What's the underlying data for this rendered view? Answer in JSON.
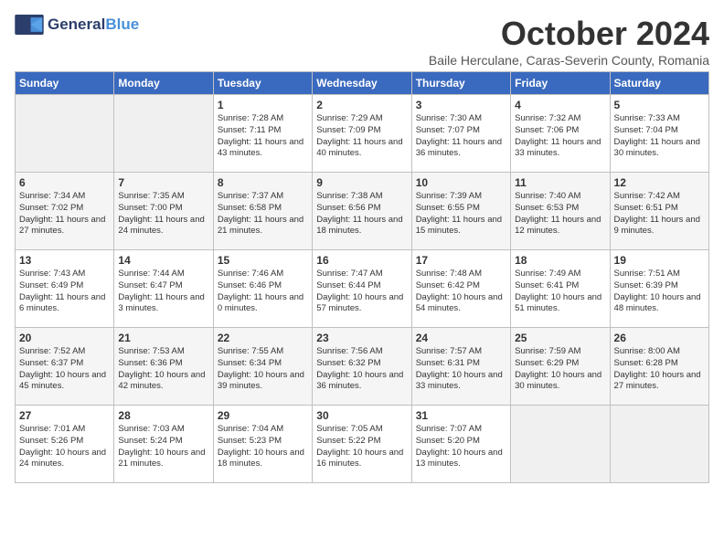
{
  "logo": {
    "general": "General",
    "blue": "Blue"
  },
  "title": "October 2024",
  "subtitle": "Baile Herculane, Caras-Severin County, Romania",
  "weekdays": [
    "Sunday",
    "Monday",
    "Tuesday",
    "Wednesday",
    "Thursday",
    "Friday",
    "Saturday"
  ],
  "weeks": [
    [
      {
        "day": "",
        "detail": ""
      },
      {
        "day": "",
        "detail": ""
      },
      {
        "day": "1",
        "detail": "Sunrise: 7:28 AM\nSunset: 7:11 PM\nDaylight: 11 hours and 43 minutes."
      },
      {
        "day": "2",
        "detail": "Sunrise: 7:29 AM\nSunset: 7:09 PM\nDaylight: 11 hours and 40 minutes."
      },
      {
        "day": "3",
        "detail": "Sunrise: 7:30 AM\nSunset: 7:07 PM\nDaylight: 11 hours and 36 minutes."
      },
      {
        "day": "4",
        "detail": "Sunrise: 7:32 AM\nSunset: 7:06 PM\nDaylight: 11 hours and 33 minutes."
      },
      {
        "day": "5",
        "detail": "Sunrise: 7:33 AM\nSunset: 7:04 PM\nDaylight: 11 hours and 30 minutes."
      }
    ],
    [
      {
        "day": "6",
        "detail": "Sunrise: 7:34 AM\nSunset: 7:02 PM\nDaylight: 11 hours and 27 minutes."
      },
      {
        "day": "7",
        "detail": "Sunrise: 7:35 AM\nSunset: 7:00 PM\nDaylight: 11 hours and 24 minutes."
      },
      {
        "day": "8",
        "detail": "Sunrise: 7:37 AM\nSunset: 6:58 PM\nDaylight: 11 hours and 21 minutes."
      },
      {
        "day": "9",
        "detail": "Sunrise: 7:38 AM\nSunset: 6:56 PM\nDaylight: 11 hours and 18 minutes."
      },
      {
        "day": "10",
        "detail": "Sunrise: 7:39 AM\nSunset: 6:55 PM\nDaylight: 11 hours and 15 minutes."
      },
      {
        "day": "11",
        "detail": "Sunrise: 7:40 AM\nSunset: 6:53 PM\nDaylight: 11 hours and 12 minutes."
      },
      {
        "day": "12",
        "detail": "Sunrise: 7:42 AM\nSunset: 6:51 PM\nDaylight: 11 hours and 9 minutes."
      }
    ],
    [
      {
        "day": "13",
        "detail": "Sunrise: 7:43 AM\nSunset: 6:49 PM\nDaylight: 11 hours and 6 minutes."
      },
      {
        "day": "14",
        "detail": "Sunrise: 7:44 AM\nSunset: 6:47 PM\nDaylight: 11 hours and 3 minutes."
      },
      {
        "day": "15",
        "detail": "Sunrise: 7:46 AM\nSunset: 6:46 PM\nDaylight: 11 hours and 0 minutes."
      },
      {
        "day": "16",
        "detail": "Sunrise: 7:47 AM\nSunset: 6:44 PM\nDaylight: 10 hours and 57 minutes."
      },
      {
        "day": "17",
        "detail": "Sunrise: 7:48 AM\nSunset: 6:42 PM\nDaylight: 10 hours and 54 minutes."
      },
      {
        "day": "18",
        "detail": "Sunrise: 7:49 AM\nSunset: 6:41 PM\nDaylight: 10 hours and 51 minutes."
      },
      {
        "day": "19",
        "detail": "Sunrise: 7:51 AM\nSunset: 6:39 PM\nDaylight: 10 hours and 48 minutes."
      }
    ],
    [
      {
        "day": "20",
        "detail": "Sunrise: 7:52 AM\nSunset: 6:37 PM\nDaylight: 10 hours and 45 minutes."
      },
      {
        "day": "21",
        "detail": "Sunrise: 7:53 AM\nSunset: 6:36 PM\nDaylight: 10 hours and 42 minutes."
      },
      {
        "day": "22",
        "detail": "Sunrise: 7:55 AM\nSunset: 6:34 PM\nDaylight: 10 hours and 39 minutes."
      },
      {
        "day": "23",
        "detail": "Sunrise: 7:56 AM\nSunset: 6:32 PM\nDaylight: 10 hours and 36 minutes."
      },
      {
        "day": "24",
        "detail": "Sunrise: 7:57 AM\nSunset: 6:31 PM\nDaylight: 10 hours and 33 minutes."
      },
      {
        "day": "25",
        "detail": "Sunrise: 7:59 AM\nSunset: 6:29 PM\nDaylight: 10 hours and 30 minutes."
      },
      {
        "day": "26",
        "detail": "Sunrise: 8:00 AM\nSunset: 6:28 PM\nDaylight: 10 hours and 27 minutes."
      }
    ],
    [
      {
        "day": "27",
        "detail": "Sunrise: 7:01 AM\nSunset: 5:26 PM\nDaylight: 10 hours and 24 minutes."
      },
      {
        "day": "28",
        "detail": "Sunrise: 7:03 AM\nSunset: 5:24 PM\nDaylight: 10 hours and 21 minutes."
      },
      {
        "day": "29",
        "detail": "Sunrise: 7:04 AM\nSunset: 5:23 PM\nDaylight: 10 hours and 18 minutes."
      },
      {
        "day": "30",
        "detail": "Sunrise: 7:05 AM\nSunset: 5:22 PM\nDaylight: 10 hours and 16 minutes."
      },
      {
        "day": "31",
        "detail": "Sunrise: 7:07 AM\nSunset: 5:20 PM\nDaylight: 10 hours and 13 minutes."
      },
      {
        "day": "",
        "detail": ""
      },
      {
        "day": "",
        "detail": ""
      }
    ]
  ]
}
